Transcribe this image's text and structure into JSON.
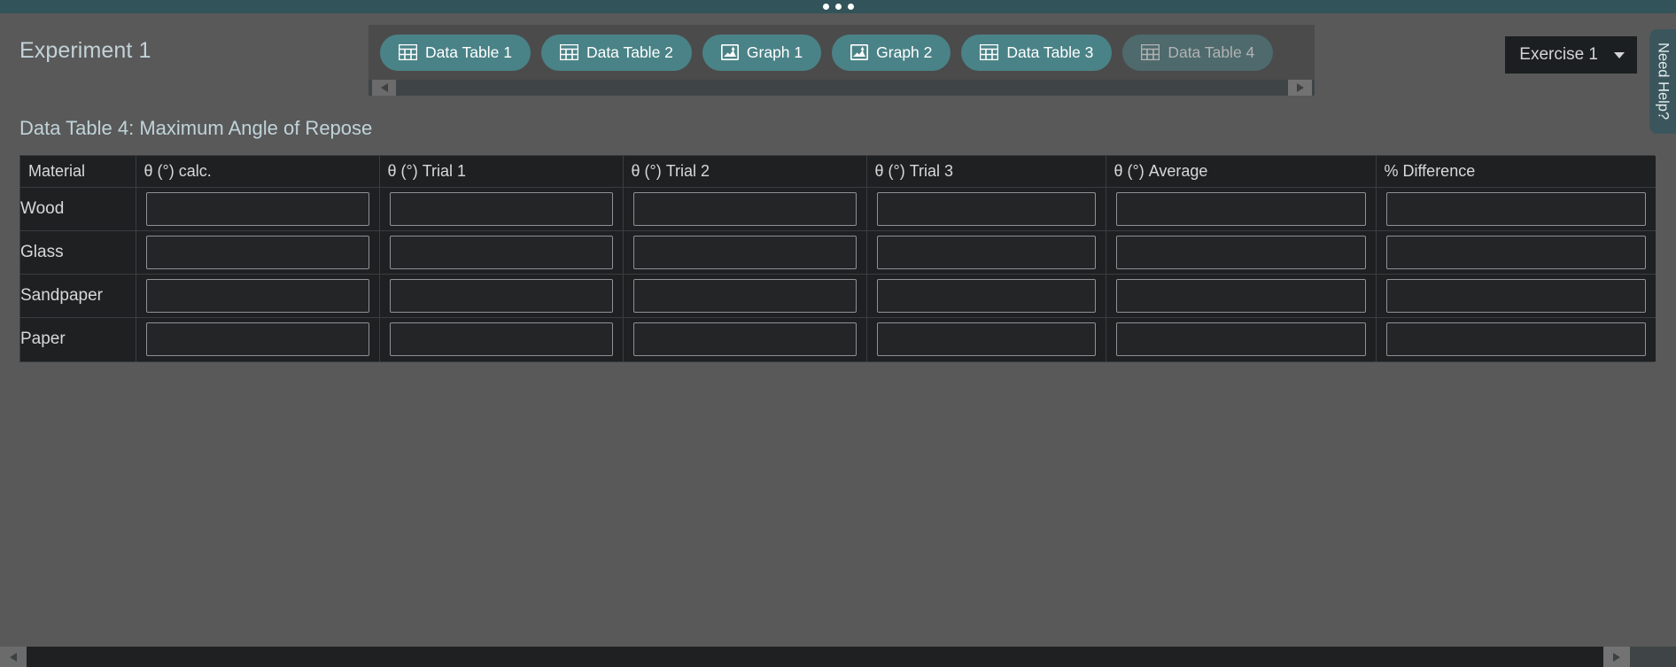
{
  "window": {
    "top_strip_icon": "three-dots",
    "accent_teal": "#4a8387",
    "active_tab_color": "#4e6a6d",
    "background": "#595959",
    "table_background": "#1e2022"
  },
  "header": {
    "experiment_title": "Experiment 1",
    "exercise_select": {
      "value": "Exercise 1",
      "caret_icon": "chevron-down-icon"
    },
    "need_help_label": "Need Help?"
  },
  "tabbar": {
    "scroll_left_label": "◀",
    "scroll_right_label": "▶",
    "tabs": [
      {
        "label": "Data Table 1",
        "icon": "table-icon",
        "active": false
      },
      {
        "label": "Data Table 2",
        "icon": "table-icon",
        "active": false
      },
      {
        "label": "Graph 1",
        "icon": "graph-icon",
        "active": false
      },
      {
        "label": "Graph 2",
        "icon": "graph-icon",
        "active": false
      },
      {
        "label": "Data Table 3",
        "icon": "table-icon",
        "active": false
      },
      {
        "label": "Data Table 4",
        "icon": "table-icon",
        "active": true
      }
    ]
  },
  "main": {
    "table_title": "Data Table 4: Maximum Angle of Repose",
    "table": {
      "columns": [
        "Material",
        "θ (°) calc.",
        "θ (°) Trial 1",
        "θ (°) Trial 2",
        "θ (°) Trial 3",
        "θ (°) Average",
        "% Difference"
      ],
      "rows": [
        {
          "material": "Wood",
          "values": [
            "",
            "",
            "",
            "",
            "",
            ""
          ]
        },
        {
          "material": "Glass",
          "values": [
            "",
            "",
            "",
            "",
            "",
            ""
          ]
        },
        {
          "material": "Sandpaper",
          "values": [
            "",
            "",
            "",
            "",
            "",
            ""
          ]
        },
        {
          "material": "Paper",
          "values": [
            "",
            "",
            "",
            "",
            "",
            ""
          ]
        }
      ]
    }
  },
  "scrollbars": {
    "horizontal_left_icon": "caret-left-icon",
    "horizontal_right_icon": "caret-right-icon"
  }
}
